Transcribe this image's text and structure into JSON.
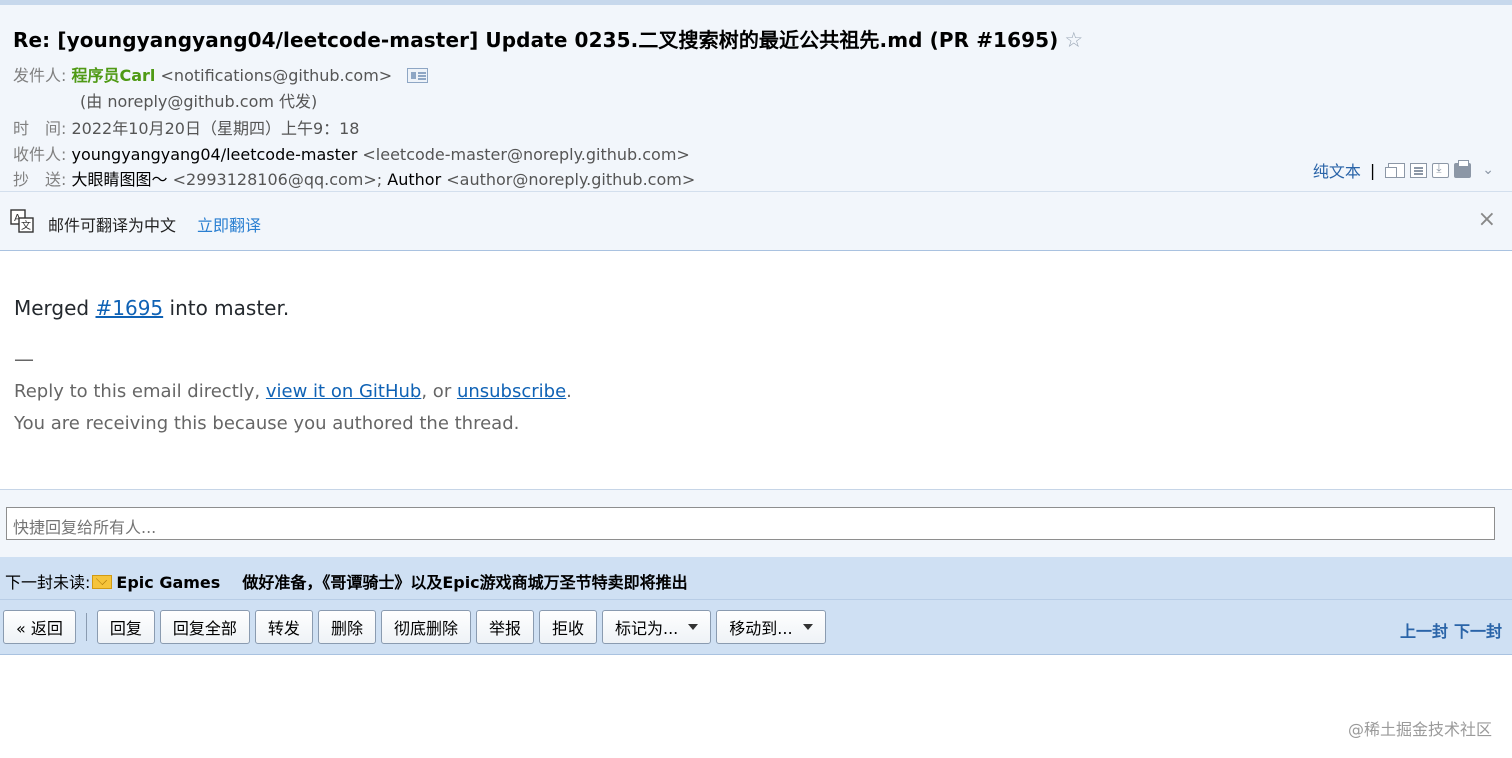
{
  "header": {
    "subject": "Re: [youngyangyang04/leetcode-master] Update 0235.二叉搜索树的最近公共祖先.md (PR #1695)",
    "star_glyph": "☆",
    "from_label": "发件人:",
    "from_name": "程序员Carl",
    "from_email": "<notifications@github.com>",
    "via": "(由 noreply@github.com 代发)",
    "time_label": "时　间:",
    "time_value": "2022年10月20日（星期四）上午9：18",
    "to_label": "收件人:",
    "to_name": "youngyangyang04/leetcode-master",
    "to_email": "<leetcode-master@noreply.github.com>",
    "cc_label": "抄　送:",
    "cc_name1": "大眼睛图图～",
    "cc_email1": "<2993128106@qq.com>;",
    "cc_name2": "Author",
    "cc_email2": "<author@noreply.github.com>",
    "plain_text": "纯文本",
    "separator": "|"
  },
  "translate": {
    "text": "邮件可翻译为中文",
    "link": "立即翻译",
    "close_glyph": "×"
  },
  "body": {
    "merged_prefix": "Merged",
    "merged_link": "#1695",
    "merged_suffix": "into master.",
    "dash": "—",
    "reply_prefix": "Reply to this email directly,",
    "reply_link1": "view it on GitHub",
    "reply_mid": ", or",
    "reply_link2": "unsubscribe",
    "reply_end": ".",
    "receiving": "You are receiving this because you authored the thread."
  },
  "quick_reply": {
    "placeholder": "快捷回复给所有人..."
  },
  "next_unread": {
    "label": "下一封未读:",
    "from": "Epic Games",
    "subject": "做好准备，《哥谭骑士》以及Epic游戏商城万圣节特卖即将推出"
  },
  "toolbar": {
    "back": "« 返回",
    "reply": "回复",
    "reply_all": "回复全部",
    "forward": "转发",
    "delete": "删除",
    "delete_permanent": "彻底删除",
    "report": "举报",
    "reject": "拒收",
    "mark_as": "标记为...",
    "move_to": "移动到...",
    "prev": "上一封",
    "next": "下一封"
  },
  "watermark": "@稀土掘金技术社区",
  "colors": {
    "header_bg": "#f2f6fb",
    "toolbar_bg": "#cfe0f3",
    "sender_green": "#4f9a15",
    "link_blue": "#0f62b5"
  }
}
